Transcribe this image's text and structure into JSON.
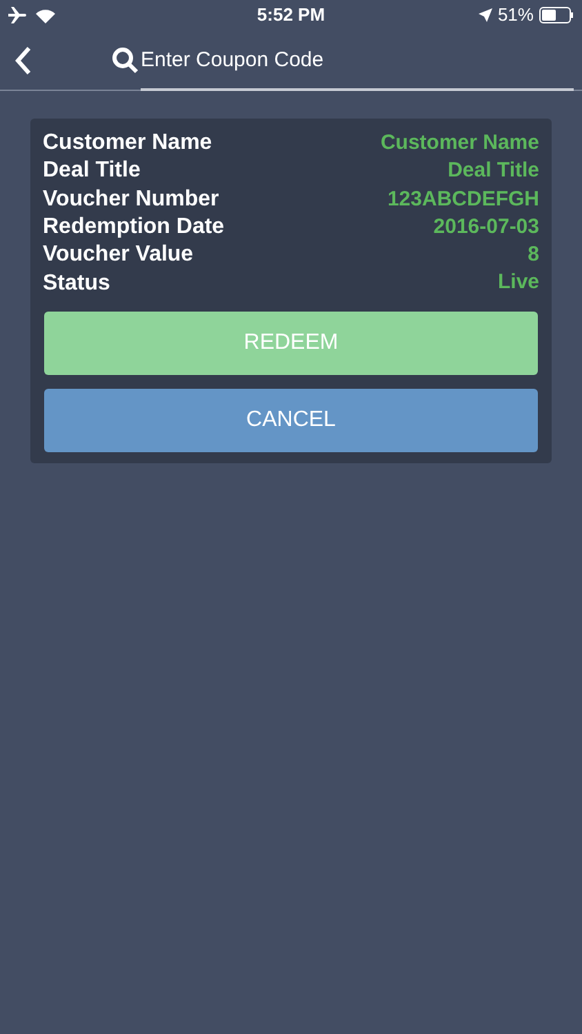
{
  "status_bar": {
    "time": "5:52 PM",
    "battery": "51%"
  },
  "search": {
    "placeholder": "Enter Coupon Code"
  },
  "details": [
    {
      "label": "Customer Name",
      "value": "Customer Name"
    },
    {
      "label": "Deal Title",
      "value": "Deal Title"
    },
    {
      "label": "Voucher Number",
      "value": "123ABCDEFGH"
    },
    {
      "label": "Redemption Date",
      "value": "2016-07-03"
    },
    {
      "label": "Voucher Value",
      "value": "8"
    },
    {
      "label": "Status",
      "value": "Live"
    }
  ],
  "buttons": [
    {
      "label": "REDEEM",
      "kind": "confirm"
    },
    {
      "label": "CANCEL",
      "kind": "cancel"
    }
  ]
}
